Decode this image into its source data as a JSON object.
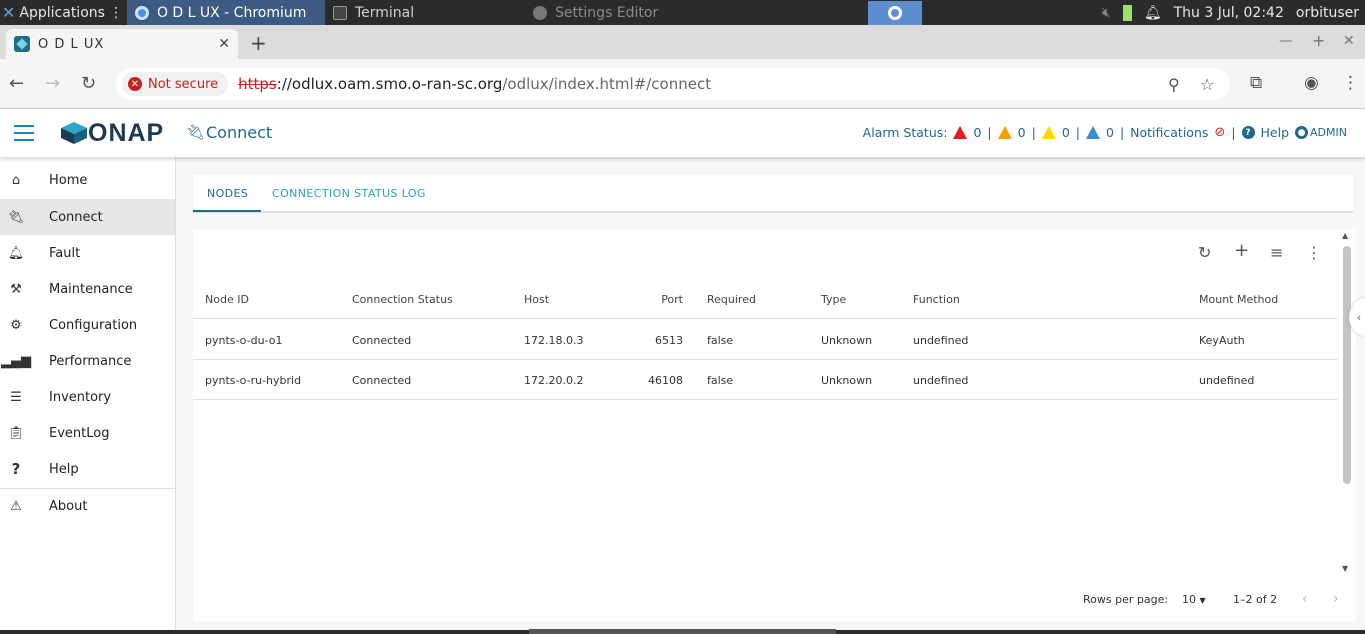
{
  "taskbar": {
    "apps_label": "Applications",
    "tasks": [
      {
        "label": "O D L UX - Chromium"
      },
      {
        "label": "Terminal"
      },
      {
        "label": "Settings Editor"
      }
    ],
    "clock": "Thu  3 Jul, 02:42",
    "user": "orbituser"
  },
  "browser": {
    "tab_title": "O D L UX",
    "not_secure": "Not secure",
    "url_scheme": "https",
    "url_host": "://odlux.oam.smo.o-ran-sc.org",
    "url_path": "/odlux/index.html#/connect"
  },
  "header": {
    "title": "Connect",
    "alarm_label": "Alarm Status:",
    "alarm_counts": [
      "0",
      "0",
      "0",
      "0"
    ],
    "notifications_label": "Notifications",
    "help_label": "Help",
    "user_label": "ADMIN",
    "logo_text": "ONAP"
  },
  "sidebar": {
    "items": [
      {
        "label": "Home",
        "icon": "home-icon"
      },
      {
        "label": "Connect",
        "icon": "plug-icon"
      },
      {
        "label": "Fault",
        "icon": "bell-icon"
      },
      {
        "label": "Maintenance",
        "icon": "tools-icon"
      },
      {
        "label": "Configuration",
        "icon": "cogs-icon"
      },
      {
        "label": "Performance",
        "icon": "bar-chart-icon"
      },
      {
        "label": "Inventory",
        "icon": "list-icon"
      },
      {
        "label": "EventLog",
        "icon": "clipboard-icon"
      },
      {
        "label": "Help",
        "icon": "question-icon"
      },
      {
        "label": "About",
        "icon": "warning-icon"
      }
    ]
  },
  "tabs": [
    {
      "label": "NODES"
    },
    {
      "label": "CONNECTION STATUS LOG"
    }
  ],
  "table": {
    "columns": [
      "Node ID",
      "Connection Status",
      "Host",
      "Port",
      "Required",
      "Type",
      "Function",
      "Mount Method"
    ],
    "rows": [
      {
        "node_id": "pynts-o-du-o1",
        "status": "Connected",
        "host": "172.18.0.3",
        "port": "6513",
        "required": "false",
        "type": "Unknown",
        "function": "undefined",
        "mount": "KeyAuth"
      },
      {
        "node_id": "pynts-o-ru-hybrid",
        "status": "Connected",
        "host": "172.20.0.2",
        "port": "46108",
        "required": "false",
        "type": "Unknown",
        "function": "undefined",
        "mount": "undefined"
      }
    ],
    "rows_per_page_label": "Rows per page:",
    "rows_per_page": "10",
    "range": "1–2 of 2"
  },
  "colors": {
    "accent": "#1e6a8c",
    "tab_link": "#27a0c8",
    "alarm_critical": "#e02020",
    "alarm_major": "#f5a000",
    "alarm_minor": "#ffd800",
    "alarm_warning": "#3a8ed0"
  }
}
